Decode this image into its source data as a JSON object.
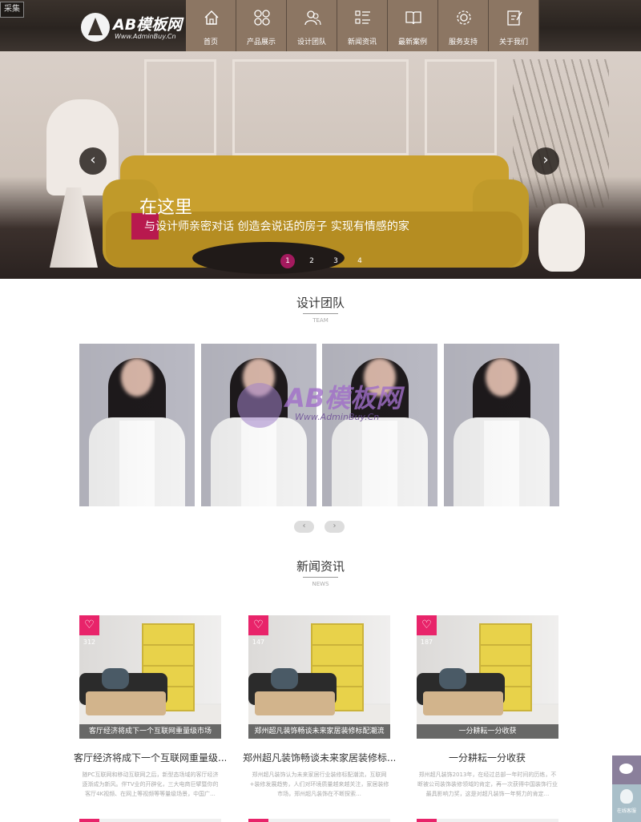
{
  "header": {
    "collect_label": "采集",
    "logo_text": "AB模板网",
    "logo_sub": "Www.AdminBuy.Cn",
    "nav": [
      {
        "label": "首页",
        "icon": "home-icon"
      },
      {
        "label": "产品展示",
        "icon": "grid-icon"
      },
      {
        "label": "设计团队",
        "icon": "team-icon"
      },
      {
        "label": "新闻资讯",
        "icon": "list-icon"
      },
      {
        "label": "最新案例",
        "icon": "book-icon"
      },
      {
        "label": "服务支持",
        "icon": "gear-icon"
      },
      {
        "label": "关于我们",
        "icon": "edit-icon"
      }
    ]
  },
  "banner": {
    "title": "在这里",
    "subtitle": "与设计师亲密对话 创造会说话的房子 实现有情感的家",
    "prev": "‹",
    "next": "›",
    "dots": [
      "1",
      "2",
      "3",
      "4"
    ],
    "active_dot": 1
  },
  "team": {
    "title": "设计团队",
    "subtitle": "TEAM",
    "prev": "‹",
    "next": "›",
    "watermark": "AB模板网",
    "watermark_sub": "Www.AdminBuy.Cn"
  },
  "news": {
    "title": "新闻资讯",
    "subtitle": "NEWS",
    "items": [
      {
        "count": "312",
        "caption": "客厅经济将成下一个互联网重量级市场",
        "title": "客厅经济将成下一个互联网重量级...",
        "desc": "随PC互联网和移动互联网之后，新型态场域的客厅经济逐渐成为新风。伴TV业的开辟化，三大电商巨擘暨你的客厅4K视频、在网上等视频等等量级场景，中国广..."
      },
      {
        "count": "147",
        "caption": "郑州超凡装饰畅谈未来家居装修标配潮流",
        "title": "郑州超凡装饰畅谈未来家居装修标...",
        "desc": "郑州超凡装饰认为未来家居行业装修标配潮流，互联网+装修发展趋势，人们对环境质量越来越关注，家居装修市场，郑州超凡装饰在不断探索..."
      },
      {
        "count": "187",
        "caption": "一分耕耘一分收获",
        "title": "一分耕耘一分收获",
        "desc": "郑州超凡装饰2013年，在经过总部一年时间的历练，不断被公司装饰装修领域的肯定，再一次获得中国装饰行业最具影响力奖，这是对超凡装饰一年努力的肯定..."
      }
    ]
  },
  "side": {
    "wechat_icon": "wechat-icon",
    "service_label": "在线客服"
  }
}
